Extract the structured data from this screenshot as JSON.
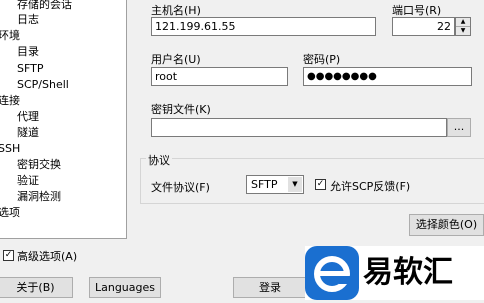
{
  "tree": {
    "items": [
      "存储的会话",
      "日志",
      "环境",
      "目录",
      "SFTP",
      "SCP/Shell",
      "连接",
      "代理",
      "隧道",
      "SSH",
      "密钥交换",
      "验证",
      "漏洞检测",
      "选项"
    ]
  },
  "session": {
    "host_label": "主机名(H)",
    "host_value": "121.199.61.55",
    "port_label": "端口号(R)",
    "port_value": "22",
    "user_label": "用户名(U)",
    "user_value": "root",
    "password_label": "密码(P)",
    "password_value": "●●●●●●●●",
    "keyfile_label": "密钥文件(K)",
    "keyfile_value": "",
    "browse_label": "..."
  },
  "protocol": {
    "group_title": "协议",
    "file_protocol_label": "文件协议(F)",
    "file_protocol_value": "SFTP",
    "allow_scp_label": "允许SCP反馈(F)",
    "allow_scp_checked": true
  },
  "footer": {
    "choose_color": "选择颜色(O)",
    "advanced": "高级选项(A)",
    "advanced_checked": true,
    "about": "关于(B)",
    "languages": "Languages",
    "login": "登录"
  },
  "watermark": {
    "text": "易软汇"
  }
}
